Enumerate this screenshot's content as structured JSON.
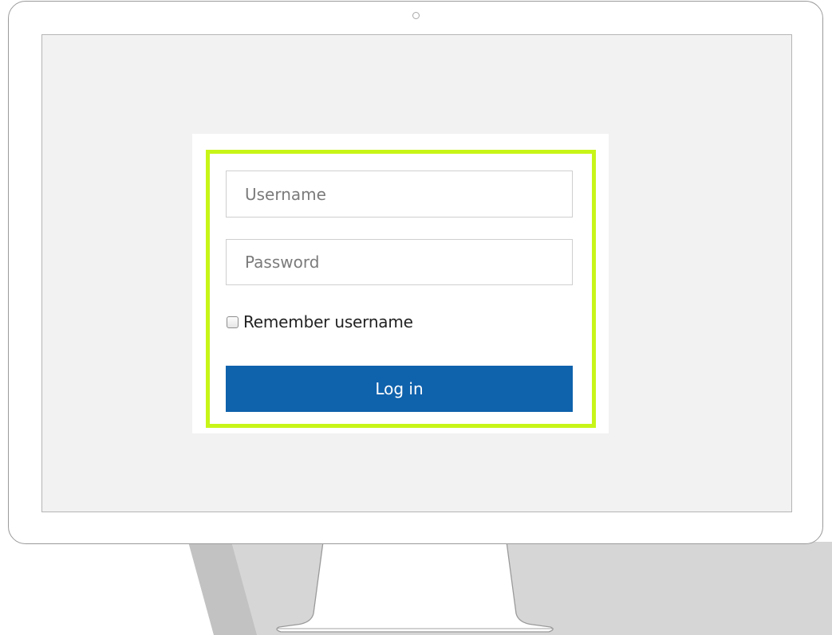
{
  "login_form": {
    "username": {
      "placeholder": "Username",
      "value": ""
    },
    "password": {
      "placeholder": "Password",
      "value": ""
    },
    "remember": {
      "label": "Remember username",
      "checked": false
    },
    "submit_label": "Log in"
  },
  "colors": {
    "primary_button": "#0f62ac",
    "highlight_border": "#c8f518",
    "screen_background": "#f2f2f2",
    "shadow": "#d6d6d6"
  }
}
